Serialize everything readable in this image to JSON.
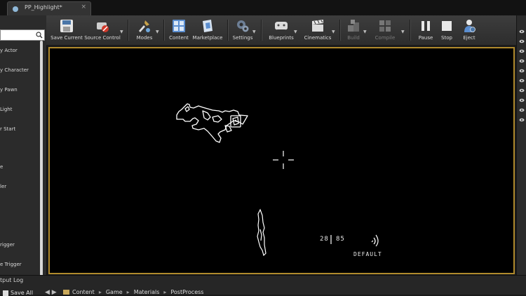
{
  "tab": {
    "title": "PP_Highlight*",
    "close": "×"
  },
  "left_panel": {
    "items": [
      "y Actor",
      "y Character",
      "y Pawn",
      "Light",
      "r Start",
      "e",
      "ler",
      "rigger",
      "e Trigger"
    ]
  },
  "toolbar": {
    "buttons": [
      {
        "label": "Save Current",
        "icon": "save-icon"
      },
      {
        "label": "Source Control",
        "icon": "source-control-icon"
      },
      {
        "label": "Modes",
        "icon": "modes-icon"
      },
      {
        "label": "Content",
        "icon": "content-icon"
      },
      {
        "label": "Marketplace",
        "icon": "marketplace-icon"
      },
      {
        "label": "Settings",
        "icon": "settings-icon"
      },
      {
        "label": "Blueprints",
        "icon": "blueprints-icon"
      },
      {
        "label": "Cinematics",
        "icon": "cinematics-icon"
      },
      {
        "label": "Build",
        "icon": "build-icon"
      },
      {
        "label": "Compile",
        "icon": "compile-icon"
      },
      {
        "label": "Pause",
        "icon": "pause-icon"
      },
      {
        "label": "Stop",
        "icon": "stop-icon"
      },
      {
        "label": "Eject",
        "icon": "eject-icon"
      }
    ]
  },
  "hud": {
    "ammo_clip": "28",
    "ammo_reserve": "85",
    "fire_mode": "DEFAULT"
  },
  "bottom": {
    "output_log": "tput Log",
    "save_all": "Save All",
    "breadcrumb": [
      "Content",
      "Game",
      "Materials",
      "PostProcess"
    ]
  },
  "colors": {
    "viewport_border": "#b08a2c",
    "viewport_bg": "#000000",
    "outline": "#ffffff"
  }
}
